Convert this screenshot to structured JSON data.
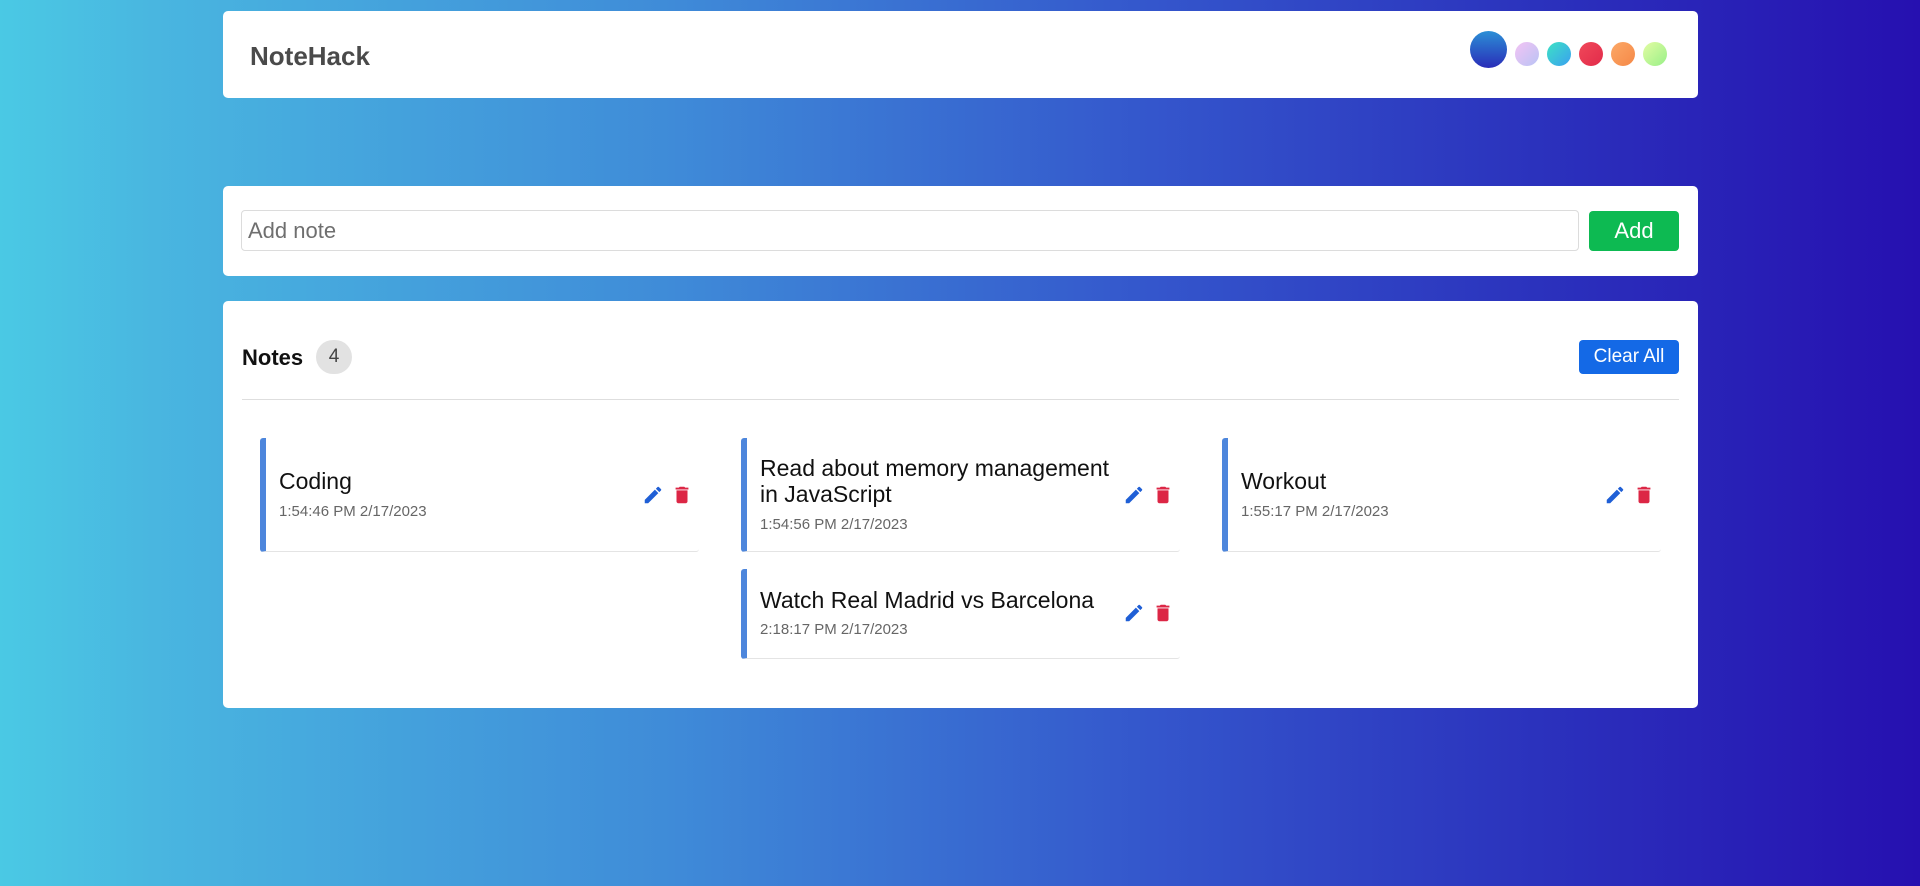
{
  "header": {
    "brand": "NoteHack",
    "theme_colors": [
      "linear-gradient(180deg, #2b8fd6 0%, #2a2cb8 100%)",
      "linear-gradient(135deg, #f3c3f3 0%, #b9c3f5 100%)",
      "linear-gradient(135deg, #3de2c4 0%, #3aa0f0 100%)",
      "linear-gradient(135deg, #f0485a 0%, #e22b4a 100%)",
      "linear-gradient(135deg, #fca867 0%, #f58847 100%)",
      "linear-gradient(135deg, #e3fca3 0%, #98f088 100%)"
    ]
  },
  "add_note": {
    "placeholder": "Add note",
    "value": "",
    "button_label": "Add"
  },
  "notes_section": {
    "title": "Notes",
    "count": "4",
    "clear_label": "Clear All",
    "accent_color": "#4d86dc"
  },
  "notes": [
    {
      "title": "Coding",
      "time": "1:54:46 PM 2/17/2023"
    },
    {
      "title": "Read about memory management in JavaScript",
      "time": "1:54:56 PM 2/17/2023"
    },
    {
      "title": "Workout",
      "time": "1:55:17 PM 2/17/2023"
    },
    {
      "title": "Watch Real Madrid vs Barcelona",
      "time": "2:18:17 PM 2/17/2023"
    }
  ],
  "icons": {
    "edit": "pencil-icon",
    "delete": "trash-icon",
    "edit_color": "#1f5fd6",
    "delete_color": "#dc2645"
  }
}
